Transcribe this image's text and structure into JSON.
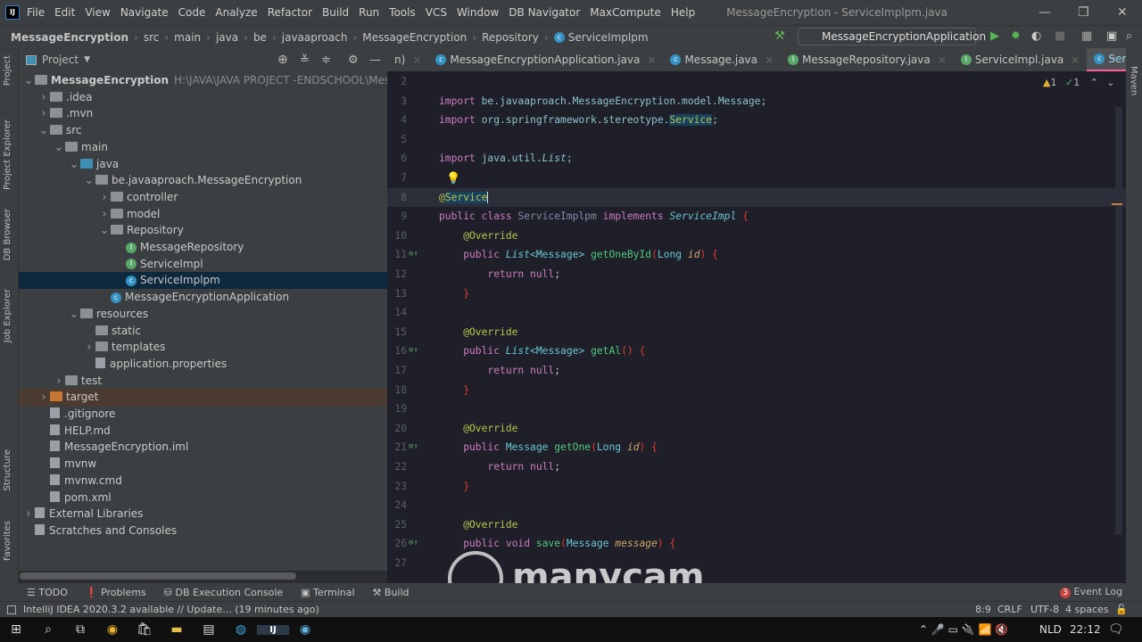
{
  "menubar": {
    "items": [
      "File",
      "Edit",
      "View",
      "Navigate",
      "Code",
      "Analyze",
      "Refactor",
      "Build",
      "Run",
      "Tools",
      "VCS",
      "Window",
      "DB Navigator",
      "MaxCompute",
      "Help"
    ],
    "title": "MessageEncryption - ServiceImplpm.java"
  },
  "breadcrumb": [
    "MessageEncryption",
    "src",
    "main",
    "java",
    "be",
    "javaaproach",
    "MessageEncryption",
    "Repository",
    "ServiceImplpm"
  ],
  "run_config": "MessageEncryptionApplication",
  "left_strip": [
    "Project",
    "Project Explorer",
    "DB Browser",
    "Job Explorer",
    "Structure",
    "Favorites"
  ],
  "right_strip": [
    "Maven"
  ],
  "project_panel": {
    "title": "Project"
  },
  "tree": [
    {
      "label": "MessageEncryption",
      "path": "H:\\JAVA\\JAVA PROJECT -ENDSCHOOL\\MessageEncryp",
      "depth": 0,
      "arrow": "down",
      "icon": "folder",
      "bold": true
    },
    {
      "label": ".idea",
      "depth": 1,
      "arrow": "right",
      "icon": "folder"
    },
    {
      "label": ".mvn",
      "depth": 1,
      "arrow": "right",
      "icon": "folder"
    },
    {
      "label": "src",
      "depth": 1,
      "arrow": "down",
      "icon": "folder"
    },
    {
      "label": "main",
      "depth": 2,
      "arrow": "down",
      "icon": "folder"
    },
    {
      "label": "java",
      "depth": 3,
      "arrow": "down",
      "icon": "folder-blue"
    },
    {
      "label": "be.javaaproach.MessageEncryption",
      "depth": 4,
      "arrow": "down",
      "icon": "package"
    },
    {
      "label": "controller",
      "depth": 5,
      "arrow": "right",
      "icon": "package"
    },
    {
      "label": "model",
      "depth": 5,
      "arrow": "right",
      "icon": "package"
    },
    {
      "label": "Repository",
      "depth": 5,
      "arrow": "down",
      "icon": "package"
    },
    {
      "label": "MessageRepository",
      "depth": 6,
      "icon": "interface"
    },
    {
      "label": "ServiceImpl",
      "depth": 6,
      "icon": "interface"
    },
    {
      "label": "ServiceImplpm",
      "depth": 6,
      "icon": "class",
      "selected": true
    },
    {
      "label": "MessageEncryptionApplication",
      "depth": 5,
      "icon": "class"
    },
    {
      "label": "resources",
      "depth": 3,
      "arrow": "down",
      "icon": "folder"
    },
    {
      "label": "static",
      "depth": 4,
      "icon": "folder"
    },
    {
      "label": "templates",
      "depth": 4,
      "arrow": "right",
      "icon": "folder"
    },
    {
      "label": "application.properties",
      "depth": 4,
      "icon": "file"
    },
    {
      "label": "test",
      "depth": 2,
      "arrow": "right",
      "icon": "folder"
    },
    {
      "label": "target",
      "depth": 1,
      "arrow": "right",
      "icon": "folder-orange",
      "highlight": true
    },
    {
      "label": ".gitignore",
      "depth": 1,
      "icon": "file"
    },
    {
      "label": "HELP.md",
      "depth": 1,
      "icon": "file"
    },
    {
      "label": "MessageEncryption.iml",
      "depth": 1,
      "icon": "file"
    },
    {
      "label": "mvnw",
      "depth": 1,
      "icon": "file"
    },
    {
      "label": "mvnw.cmd",
      "depth": 1,
      "icon": "file"
    },
    {
      "label": "pom.xml",
      "depth": 1,
      "icon": "file"
    },
    {
      "label": "External Libraries",
      "depth": 0,
      "arrow": "right",
      "icon": "library"
    },
    {
      "label": "Scratches and Consoles",
      "depth": 0,
      "icon": "scratch"
    }
  ],
  "tabs": [
    {
      "label": "n)",
      "icon": "none"
    },
    {
      "label": "MessageEncryptionApplication.java",
      "icon": "class"
    },
    {
      "label": "Message.java",
      "icon": "class"
    },
    {
      "label": "MessageRepository.java",
      "icon": "interface"
    },
    {
      "label": "ServiceImpl.java",
      "icon": "interface"
    },
    {
      "label": "ServiceImplpm.java",
      "icon": "class",
      "active": true
    }
  ],
  "inspections": {
    "warnings": "1",
    "weak_warnings": "1"
  },
  "code": [
    {
      "n": "2",
      "t": []
    },
    {
      "n": "3",
      "t": [
        [
          "import ",
          "kw"
        ],
        [
          "be.javaaproach.MessageEncryption.model.Message;",
          "pk"
        ]
      ]
    },
    {
      "n": "4",
      "t": [
        [
          "import ",
          "kw"
        ],
        [
          "org.springframework.stereotype.",
          "pk"
        ],
        [
          "Service",
          "an selt"
        ],
        [
          ";",
          "pk"
        ]
      ]
    },
    {
      "n": "5",
      "t": []
    },
    {
      "n": "6",
      "t": [
        [
          "import ",
          "kw"
        ],
        [
          "java.util.",
          "pk"
        ],
        [
          "List",
          "pk it"
        ],
        [
          ";",
          "pk"
        ]
      ]
    },
    {
      "n": "7",
      "t": []
    },
    {
      "n": "8",
      "t": [
        [
          "@",
          "an"
        ],
        [
          "Service",
          "an selt"
        ]
      ],
      "cur": true
    },
    {
      "n": "9",
      "t": [
        [
          "public class ",
          "kw"
        ],
        [
          "ServiceImplpm",
          "cn"
        ],
        [
          " implements ",
          "kw"
        ],
        [
          "ServiceImpl",
          "ty it"
        ],
        [
          " {",
          "br"
        ]
      ]
    },
    {
      "n": "10",
      "t": [
        [
          "    @Override",
          "an"
        ]
      ]
    },
    {
      "n": "11",
      "t": [
        [
          "    public ",
          "kw"
        ],
        [
          "List",
          "ty it"
        ],
        [
          "<Message> ",
          "ty"
        ],
        [
          "getOneById",
          "fn"
        ],
        [
          "(",
          "br"
        ],
        [
          "Long ",
          "ty"
        ],
        [
          "id",
          "pa"
        ],
        [
          ")",
          "br"
        ],
        [
          " {",
          "br"
        ]
      ],
      "g": true
    },
    {
      "n": "12",
      "t": [
        [
          "        return null",
          "kw"
        ],
        [
          ";",
          "pl"
        ]
      ]
    },
    {
      "n": "13",
      "t": [
        [
          "    }",
          "br"
        ]
      ]
    },
    {
      "n": "14",
      "t": []
    },
    {
      "n": "15",
      "t": [
        [
          "    @Override",
          "an"
        ]
      ]
    },
    {
      "n": "16",
      "t": [
        [
          "    public ",
          "kw"
        ],
        [
          "List",
          "ty it"
        ],
        [
          "<Message> ",
          "ty"
        ],
        [
          "getAl",
          "fn"
        ],
        [
          "()",
          "br"
        ],
        [
          " {",
          "br"
        ]
      ],
      "g": true
    },
    {
      "n": "17",
      "t": [
        [
          "        return null",
          "kw"
        ],
        [
          ";",
          "pl"
        ]
      ]
    },
    {
      "n": "18",
      "t": [
        [
          "    }",
          "br"
        ]
      ]
    },
    {
      "n": "19",
      "t": []
    },
    {
      "n": "20",
      "t": [
        [
          "    @Override",
          "an"
        ]
      ]
    },
    {
      "n": "21",
      "t": [
        [
          "    public ",
          "kw"
        ],
        [
          "Message ",
          "ty"
        ],
        [
          "getOne",
          "fn"
        ],
        [
          "(",
          "br"
        ],
        [
          "Long ",
          "ty"
        ],
        [
          "id",
          "pa"
        ],
        [
          ")",
          "br"
        ],
        [
          " {",
          "br"
        ]
      ],
      "g": true
    },
    {
      "n": "22",
      "t": [
        [
          "        return null",
          "kw"
        ],
        [
          ";",
          "pl"
        ]
      ]
    },
    {
      "n": "23",
      "t": [
        [
          "    }",
          "br"
        ]
      ]
    },
    {
      "n": "24",
      "t": []
    },
    {
      "n": "25",
      "t": [
        [
          "    @Override",
          "an"
        ]
      ]
    },
    {
      "n": "26",
      "t": [
        [
          "    public void ",
          "kw"
        ],
        [
          "save",
          "fn"
        ],
        [
          "(",
          "br"
        ],
        [
          "Message ",
          "ty"
        ],
        [
          "message",
          "pa"
        ],
        [
          ")",
          "br"
        ],
        [
          " {",
          "br"
        ]
      ],
      "g": true
    },
    {
      "n": "27",
      "t": []
    }
  ],
  "tool_windows": [
    "TODO",
    "Problems",
    "DB Execution Console",
    "Terminal",
    "Build"
  ],
  "event_log": {
    "count": "3",
    "label": "Event Log"
  },
  "status": {
    "message": "IntelliJ IDEA 2020.3.2 available // Update... (19 minutes ago)",
    "position": "8:9",
    "line_sep": "CRLF",
    "encoding": "UTF-8",
    "indent": "4 spaces"
  },
  "taskbar": {
    "lang": "NLD",
    "time": "22:12"
  },
  "watermark": "manycam",
  "colors": {
    "accent_tab": "#ff5fa0",
    "selection": "#0d293e",
    "editor_bg": "#1e1f29"
  }
}
